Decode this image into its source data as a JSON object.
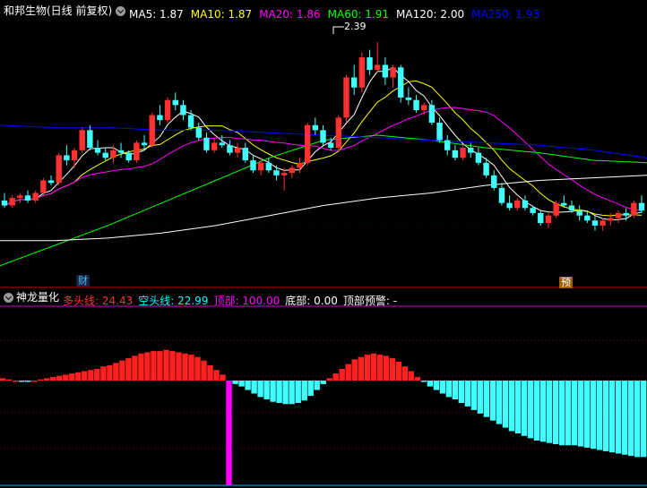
{
  "header": {
    "stock_name": "和邦生物(日线 前复权)",
    "ma": [
      {
        "label": "MA5: 1.87",
        "color": "#ffffff"
      },
      {
        "label": "MA10: 1.87",
        "color": "#ffff00"
      },
      {
        "label": "MA20: 1.86",
        "color": "#ff00ff"
      },
      {
        "label": "MA60: 1.91",
        "color": "#00ff00"
      },
      {
        "label": "MA120: 2.00",
        "color": "#ffffff"
      },
      {
        "label": "MA250: 1.93",
        "color": "#0000ff"
      }
    ],
    "price_annotation": "2.39",
    "marker_cai": "财",
    "marker_yu": "预"
  },
  "indicator": {
    "name": "神龙量化",
    "fields": [
      {
        "label": "多头线: 24.43",
        "color": "#ff3030"
      },
      {
        "label": "空头线: 22.99",
        "color": "#00ffff"
      },
      {
        "label": "顶部: 100.00",
        "color": "#ff00ff"
      },
      {
        "label": "底部: 0.00",
        "color": "#ffffff"
      },
      {
        "label": "顶部预警: -",
        "color": "#ffffff"
      }
    ]
  },
  "colors": {
    "up": "#ff3030",
    "down": "#40ffff",
    "bull_bar": "#ff2020",
    "bear_bar": "#40ffff",
    "top_signal": "#ff00ff",
    "grid": "#7a0000"
  },
  "chart_data": [
    {
      "type": "candlestick",
      "title": "和邦生物(日线 前复权)",
      "annotations": [
        "2.39"
      ],
      "ohlc": [
        [
          1.76,
          1.79,
          1.73,
          1.74
        ],
        [
          1.74,
          1.78,
          1.73,
          1.77
        ],
        [
          1.77,
          1.79,
          1.75,
          1.78
        ],
        [
          1.78,
          1.8,
          1.75,
          1.76
        ],
        [
          1.76,
          1.8,
          1.75,
          1.79
        ],
        [
          1.79,
          1.85,
          1.78,
          1.84
        ],
        [
          1.84,
          1.86,
          1.82,
          1.83
        ],
        [
          1.83,
          1.95,
          1.82,
          1.94
        ],
        [
          1.94,
          1.98,
          1.9,
          1.92
        ],
        [
          1.92,
          1.97,
          1.89,
          1.96
        ],
        [
          1.96,
          2.05,
          1.95,
          2.04
        ],
        [
          2.04,
          2.06,
          1.96,
          1.97
        ],
        [
          1.97,
          2.0,
          1.94,
          1.95
        ],
        [
          1.95,
          1.97,
          1.92,
          1.93
        ],
        [
          1.93,
          1.98,
          1.91,
          1.96
        ],
        [
          1.96,
          1.99,
          1.93,
          1.95
        ],
        [
          1.95,
          1.96,
          1.91,
          1.92
        ],
        [
          1.92,
          2.0,
          1.91,
          1.99
        ],
        [
          1.99,
          2.02,
          1.96,
          1.98
        ],
        [
          1.98,
          2.11,
          1.97,
          2.1
        ],
        [
          2.1,
          2.14,
          2.06,
          2.08
        ],
        [
          2.08,
          2.17,
          2.07,
          2.16
        ],
        [
          2.16,
          2.19,
          2.12,
          2.14
        ],
        [
          2.14,
          2.16,
          2.08,
          2.1
        ],
        [
          2.1,
          2.12,
          2.04,
          2.05
        ],
        [
          2.05,
          2.07,
          2.0,
          2.01
        ],
        [
          2.01,
          2.03,
          1.95,
          1.96
        ],
        [
          1.96,
          2.01,
          1.95,
          1.99
        ],
        [
          1.99,
          2.02,
          1.97,
          1.98
        ],
        [
          1.98,
          2.0,
          1.94,
          1.95
        ],
        [
          1.95,
          1.99,
          1.93,
          1.97
        ],
        [
          1.97,
          1.99,
          1.91,
          1.92
        ],
        [
          1.92,
          1.94,
          1.87,
          1.88
        ],
        [
          1.88,
          1.93,
          1.86,
          1.91
        ],
        [
          1.91,
          1.93,
          1.87,
          1.88
        ],
        [
          1.88,
          1.9,
          1.84,
          1.86
        ],
        [
          1.86,
          1.89,
          1.8,
          1.87
        ],
        [
          1.87,
          1.9,
          1.85,
          1.89
        ],
        [
          1.89,
          1.93,
          1.87,
          1.91
        ],
        [
          1.91,
          2.07,
          1.9,
          2.06
        ],
        [
          2.06,
          2.09,
          2.02,
          2.04
        ],
        [
          2.04,
          2.06,
          1.98,
          1.99
        ],
        [
          1.99,
          2.01,
          1.96,
          1.97
        ],
        [
          1.97,
          2.1,
          1.96,
          2.09
        ],
        [
          2.09,
          2.26,
          2.07,
          2.25
        ],
        [
          2.25,
          2.3,
          2.18,
          2.21
        ],
        [
          2.21,
          2.35,
          2.19,
          2.33
        ],
        [
          2.33,
          2.36,
          2.26,
          2.28
        ],
        [
          2.28,
          2.39,
          2.27,
          2.3
        ],
        [
          2.3,
          2.33,
          2.22,
          2.25
        ],
        [
          2.25,
          2.3,
          2.21,
          2.29
        ],
        [
          2.29,
          2.3,
          2.15,
          2.17
        ],
        [
          2.17,
          2.21,
          2.14,
          2.16
        ],
        [
          2.16,
          2.18,
          2.11,
          2.12
        ],
        [
          2.12,
          2.15,
          2.1,
          2.14
        ],
        [
          2.14,
          2.16,
          2.06,
          2.07
        ],
        [
          2.07,
          2.09,
          1.99,
          2.0
        ],
        [
          2.0,
          2.02,
          1.94,
          1.96
        ],
        [
          1.96,
          1.98,
          1.92,
          1.93
        ],
        [
          1.93,
          1.98,
          1.92,
          1.97
        ],
        [
          1.97,
          1.99,
          1.93,
          1.95
        ],
        [
          1.95,
          1.97,
          1.9,
          1.91
        ],
        [
          1.91,
          1.93,
          1.85,
          1.86
        ],
        [
          1.86,
          1.88,
          1.8,
          1.81
        ],
        [
          1.81,
          1.83,
          1.74,
          1.75
        ],
        [
          1.75,
          1.78,
          1.72,
          1.73
        ],
        [
          1.73,
          1.77,
          1.72,
          1.76
        ],
        [
          1.76,
          1.78,
          1.72,
          1.73
        ],
        [
          1.73,
          1.74,
          1.7,
          1.71
        ],
        [
          1.71,
          1.72,
          1.66,
          1.67
        ],
        [
          1.67,
          1.71,
          1.65,
          1.7
        ],
        [
          1.7,
          1.76,
          1.69,
          1.75
        ],
        [
          1.75,
          1.78,
          1.73,
          1.74
        ],
        [
          1.74,
          1.76,
          1.71,
          1.72
        ],
        [
          1.72,
          1.74,
          1.68,
          1.7
        ],
        [
          1.7,
          1.72,
          1.67,
          1.68
        ],
        [
          1.68,
          1.7,
          1.64,
          1.66
        ],
        [
          1.66,
          1.69,
          1.64,
          1.68
        ],
        [
          1.68,
          1.71,
          1.66,
          1.69
        ],
        [
          1.69,
          1.72,
          1.67,
          1.71
        ],
        [
          1.71,
          1.73,
          1.68,
          1.7
        ],
        [
          1.7,
          1.76,
          1.69,
          1.75
        ],
        [
          1.75,
          1.78,
          1.71,
          1.72
        ]
      ],
      "series": [
        {
          "name": "MA5",
          "color": "#ffffff"
        },
        {
          "name": "MA10",
          "color": "#ffff00"
        },
        {
          "name": "MA20",
          "color": "#ff00ff"
        },
        {
          "name": "MA60",
          "color": "#00ff00",
          "values": [
            1.5,
            1.58,
            1.66,
            1.75,
            1.84,
            1.93,
            2.0,
            2.02,
            2.0,
            1.97,
            1.95,
            1.92,
            1.91
          ]
        },
        {
          "name": "MA120",
          "color": "#ffffff",
          "values": [
            1.6,
            1.6,
            1.61,
            1.63,
            1.66,
            1.7,
            1.74,
            1.77,
            1.79,
            1.82,
            1.84,
            1.85,
            1.86
          ]
        },
        {
          "name": "MA250",
          "color": "#0000ff",
          "values": [
            2.06,
            2.05,
            2.05,
            2.04,
            2.04,
            2.03,
            2.02,
            2.01,
            2.0,
            1.99,
            1.98,
            1.96,
            1.93
          ]
        }
      ],
      "ylim": [
        1.46,
        2.48
      ],
      "grid": true
    },
    {
      "type": "bar",
      "title": "神龙量化",
      "series": [
        {
          "name": "多头线",
          "color": "#ff2020"
        },
        {
          "name": "空头线",
          "color": "#40ffff"
        },
        {
          "name": "顶部",
          "color": "#ff00ff"
        }
      ],
      "values": [
        2,
        1,
        0,
        -1,
        -1,
        0,
        1,
        2,
        3,
        4,
        5,
        6,
        7,
        8,
        9,
        10,
        12,
        13,
        15,
        17,
        19,
        21,
        23,
        24,
        25,
        25,
        26,
        25,
        24,
        23,
        22,
        20,
        17,
        13,
        9,
        5,
        0,
        -3,
        -5,
        -8,
        -11,
        -14,
        -16,
        -18,
        -19,
        -20,
        -20,
        -19,
        -17,
        -13,
        -8,
        -3,
        2,
        6,
        10,
        14,
        18,
        20,
        22,
        23,
        22,
        21,
        19,
        16,
        12,
        8,
        3,
        -1,
        -5,
        -8,
        -11,
        -14,
        -16,
        -19,
        -22,
        -25,
        -28,
        -31,
        -34,
        -37,
        -40,
        -43,
        -45,
        -47,
        -49,
        -51,
        -52,
        -53,
        -54,
        -55,
        -55,
        -55,
        -56,
        -57,
        -58,
        -59,
        -60,
        -61,
        -62,
        -63,
        -64,
        -65,
        -65
      ],
      "top_signal_index": 36,
      "top_signal_value": -50,
      "ylim": [
        -70,
        30
      ]
    }
  ]
}
